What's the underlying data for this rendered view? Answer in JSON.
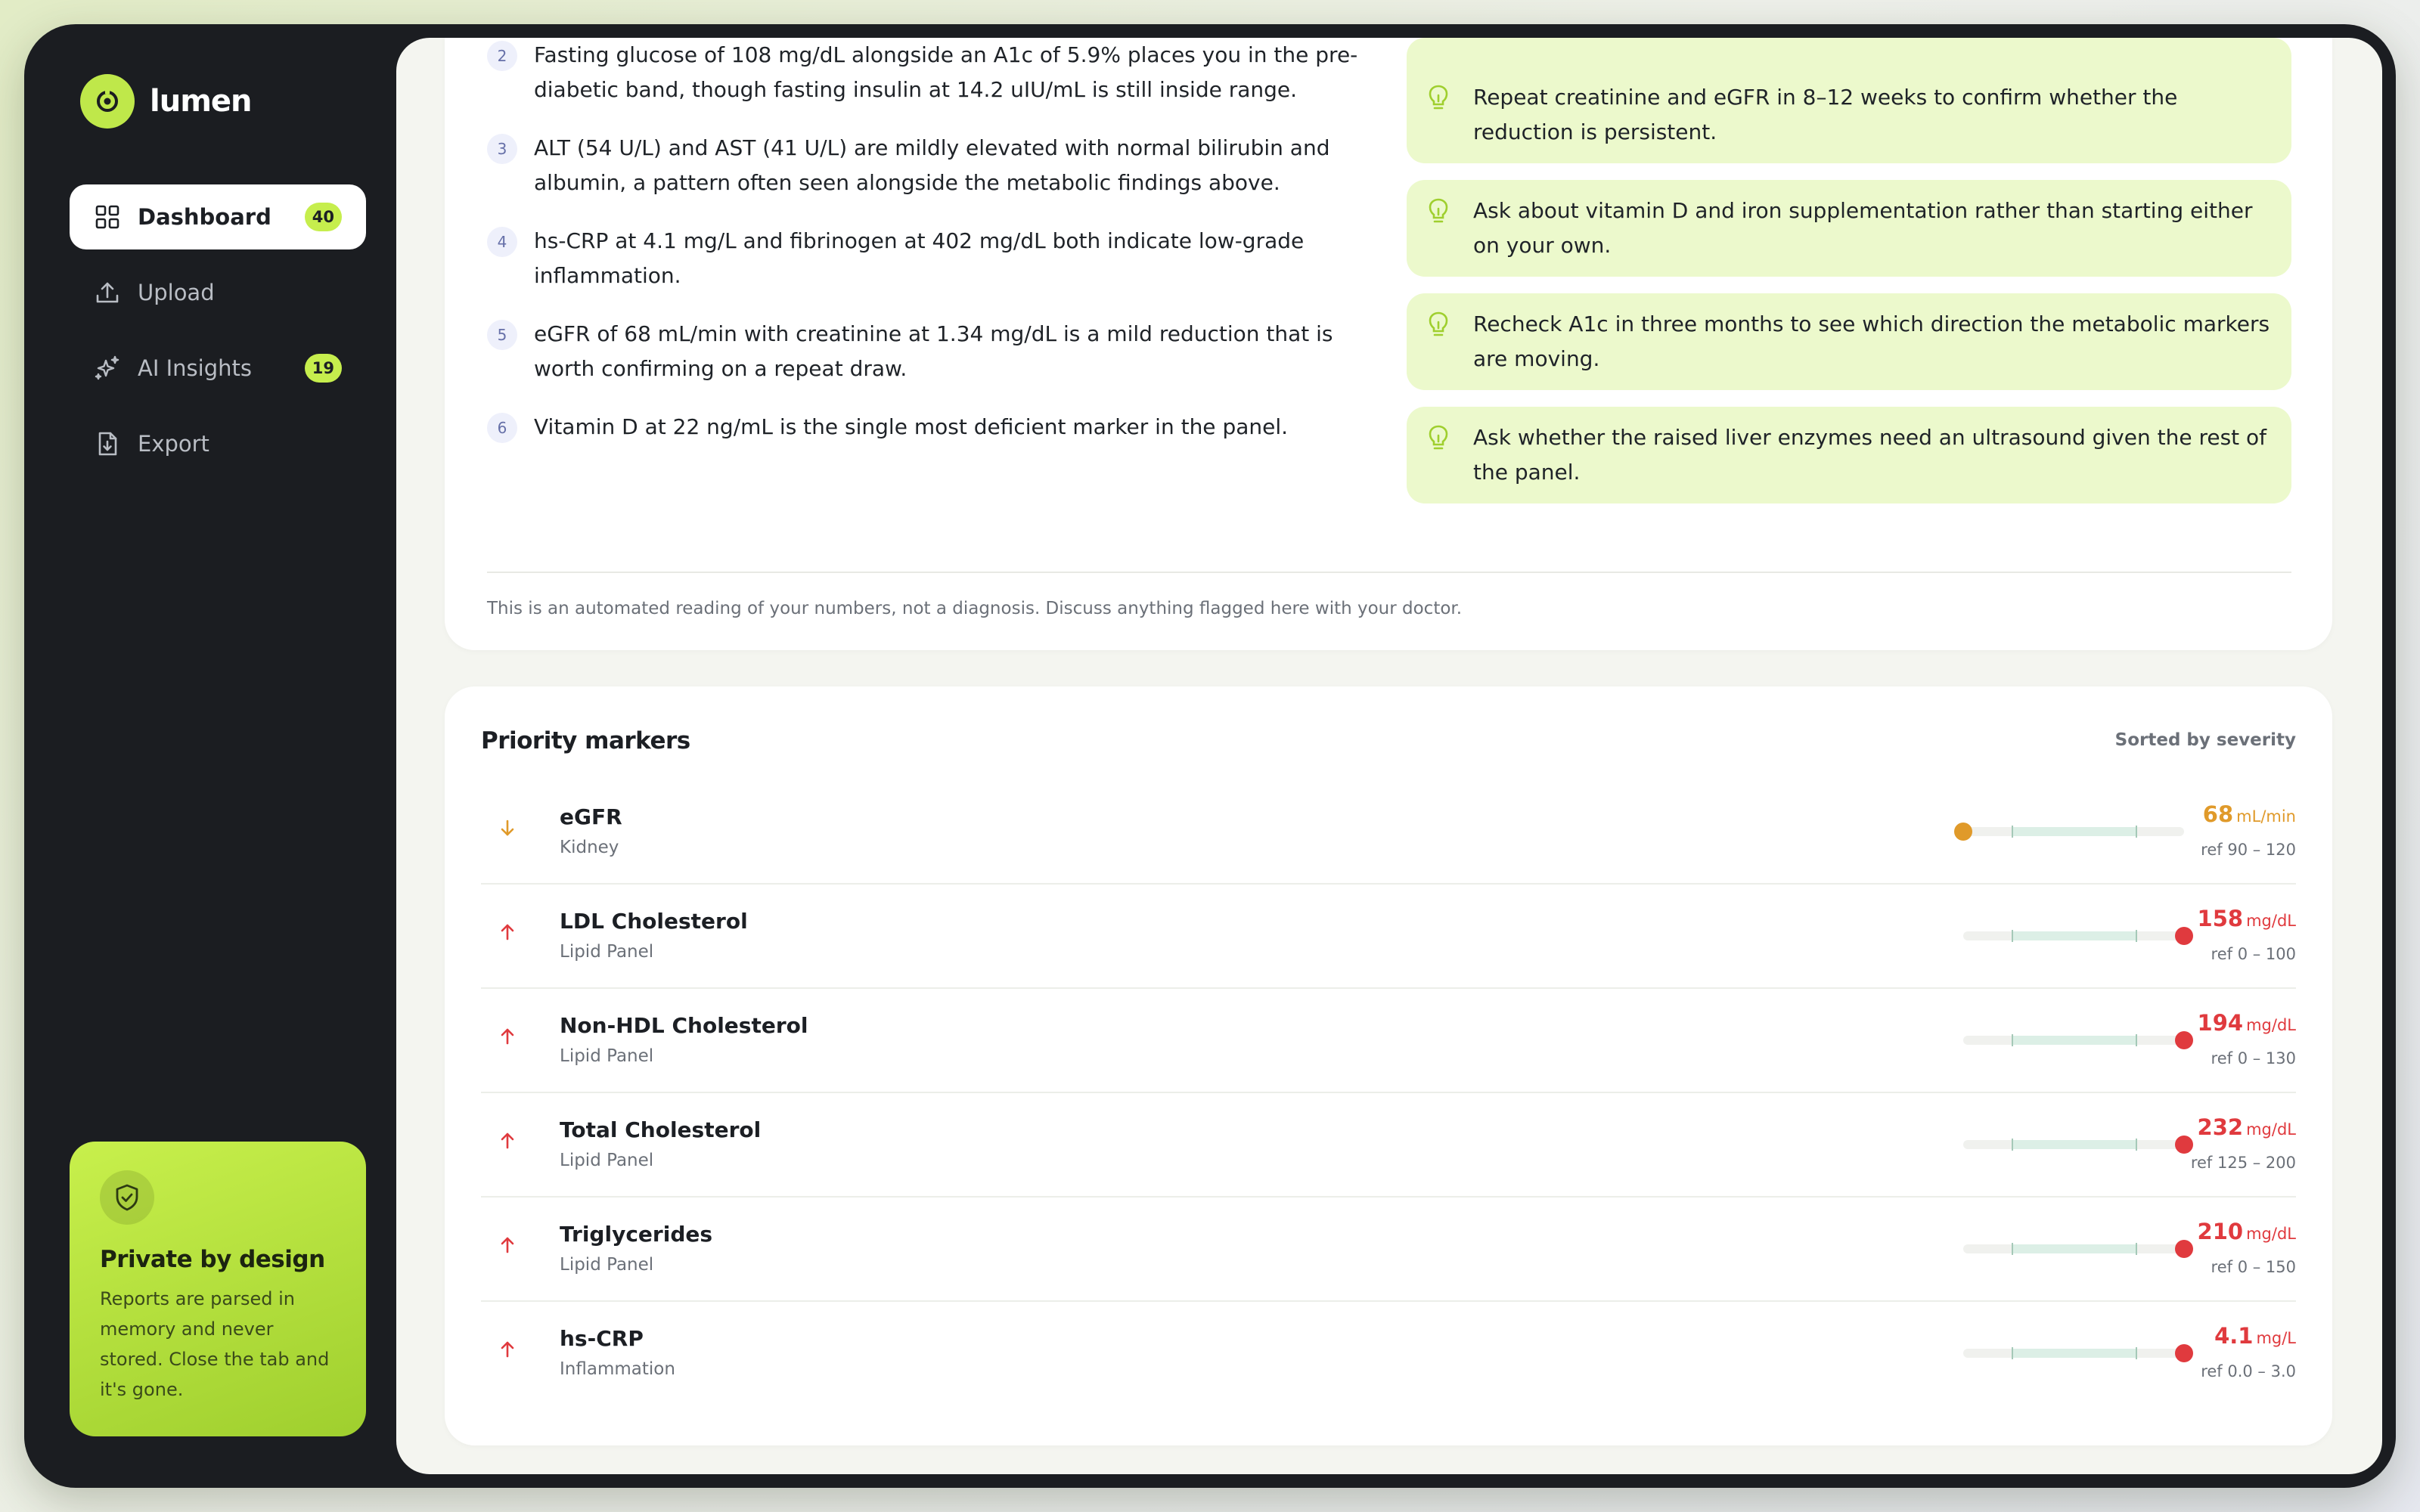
{
  "app": {
    "brand": "lumen"
  },
  "sidebar": {
    "items": [
      {
        "label": "Dashboard",
        "badge": "40",
        "active": true,
        "icon": "grid-icon"
      },
      {
        "label": "Upload",
        "badge": "",
        "icon": "upload-icon"
      },
      {
        "label": "AI Insights",
        "badge": "19",
        "icon": "sparkle-icon"
      },
      {
        "label": "Export",
        "badge": "",
        "icon": "file-export-icon"
      }
    ],
    "privacy": {
      "title": "Private by design",
      "text": "Reports are parsed in memory and never stored. Close the tab and it's gone."
    }
  },
  "summary": {
    "findings": [
      {
        "num": "2",
        "text": "Fasting glucose of 108 mg/dL alongside an A1c of 5.9% places you in the pre-diabetic band, though fasting insulin at 14.2 uIU/mL is still inside range."
      },
      {
        "num": "3",
        "text": "ALT (54 U/L) and AST (41 U/L) are mildly elevated with normal bilirubin and albumin, a pattern often seen alongside the metabolic findings above."
      },
      {
        "num": "4",
        "text": "hs-CRP at 4.1 mg/L and fibrinogen at 402 mg/dL both indicate low-grade inflammation."
      },
      {
        "num": "5",
        "text": "eGFR of 68 mL/min with creatinine at 1.34 mg/dL is a mild reduction that is worth confirming on a repeat draw."
      },
      {
        "num": "6",
        "text": "Vitamin D at 22 ng/mL is the single most deficient marker in the panel."
      }
    ],
    "tips": [
      {
        "text": "Repeat creatinine and eGFR in 8–12 weeks to confirm whether the reduction is persistent."
      },
      {
        "text": "Ask about vitamin D and iron supplementation rather than starting either on your own."
      },
      {
        "text": "Recheck A1c in three months to see which direction the metabolic markers are moving."
      },
      {
        "text": "Ask whether the raised liver enzymes need an ultrasound given the rest of the panel."
      }
    ],
    "disclaimer": "This is an automated reading of your numbers, not a diagnosis. Discuss anything flagged here with your doctor."
  },
  "markers": {
    "title": "Priority markers",
    "sort_label": "Sorted by severity",
    "colors": {
      "low": "#e09a2a",
      "high": "#e03a3e"
    },
    "items": [
      {
        "name": "eGFR",
        "category": "Kidney",
        "value": "68",
        "unit": "mL/min",
        "ref": "ref 90 – 120",
        "direction": "low",
        "position": 0.0
      },
      {
        "name": "LDL Cholesterol",
        "category": "Lipid Panel",
        "value": "158",
        "unit": "mg/dL",
        "ref": "ref 0 – 100",
        "direction": "high",
        "position": 1.0
      },
      {
        "name": "Non-HDL Cholesterol",
        "category": "Lipid Panel",
        "value": "194",
        "unit": "mg/dL",
        "ref": "ref 0 – 130",
        "direction": "high",
        "position": 1.0
      },
      {
        "name": "Total Cholesterol",
        "category": "Lipid Panel",
        "value": "232",
        "unit": "mg/dL",
        "ref": "ref 125 – 200",
        "direction": "high",
        "position": 1.0
      },
      {
        "name": "Triglycerides",
        "category": "Lipid Panel",
        "value": "210",
        "unit": "mg/dL",
        "ref": "ref 0 – 150",
        "direction": "high",
        "position": 1.0
      },
      {
        "name": "hs-CRP",
        "category": "Inflammation",
        "value": "4.1",
        "unit": "mg/L",
        "ref": "ref 0.0 – 3.0",
        "direction": "high",
        "position": 1.0
      }
    ]
  }
}
